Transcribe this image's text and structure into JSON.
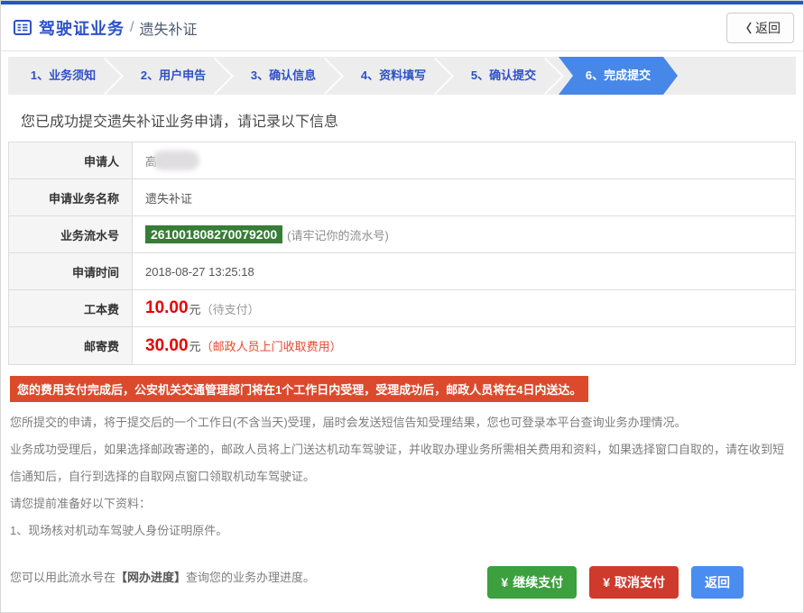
{
  "header": {
    "title": "驾驶证业务",
    "divider": "/",
    "subtitle": "遗失补证",
    "back_button": {
      "chevron": "〈",
      "label": "返回"
    }
  },
  "steps": [
    {
      "label": "1、业务须知",
      "active": false
    },
    {
      "label": "2、用户申告",
      "active": false
    },
    {
      "label": "3、确认信息",
      "active": false
    },
    {
      "label": "4、资料填写",
      "active": false
    },
    {
      "label": "5、确认提交",
      "active": false
    },
    {
      "label": "6、完成提交",
      "active": true
    }
  ],
  "main": {
    "success_message": "您已成功提交遗失补证业务申请，请记录以下信息",
    "table": {
      "rows": [
        {
          "label": "申请人",
          "value": "高"
        },
        {
          "label": "申请业务名称",
          "value": "遗失补证"
        },
        {
          "label": "业务流水号",
          "serial": "261001808270079200",
          "note": "(请牢记你的流水号)"
        },
        {
          "label": "申请时间",
          "value": "2018-08-27 13:25:18"
        },
        {
          "label": "工本费",
          "amount": "10.00",
          "unit": "元",
          "note": "（待支付）"
        },
        {
          "label": "邮寄费",
          "amount": "30.00",
          "unit": "元",
          "note": "（邮政人员上门收取费用）"
        }
      ]
    },
    "alert_banner": "您的费用支付完成后，公安机关交通管理部门将在1个工作日内受理，受理成功后，邮政人员将在4日内送达。",
    "paragraphs": [
      "您所提交的申请，将于提交后的一个工作日(不含当天)受理，届时会发送短信告知受理结果，您也可登录本平台查询业务办理情况。",
      "业务成功受理后，如果选择邮政寄递的，邮政人员将上门送达机动车驾驶证，并收取办理业务所需相关费用和资料，如果选择窗口自取的，请在收到短信通知后，自行到选择的自取网点窗口领取机动车驾驶证。",
      "请您提前准备好以下资料：",
      "1、现场核对机动车驾驶人身份证明原件。"
    ],
    "progress_note": {
      "prefix": "您可以用此流水号在",
      "link": "【网办进度】",
      "suffix": "查询您的业务办理进度。"
    }
  },
  "footer": {
    "buttons": [
      {
        "currency": "¥",
        "label": "继续支付"
      },
      {
        "currency": "¥",
        "label": "取消支付"
      },
      {
        "label": "返回"
      }
    ]
  },
  "colors": {
    "top_bar": "#2257c4",
    "accent_blue": "#2d51c8",
    "step_active": "#4687e8",
    "serial_badge": "#377d37",
    "alert_banner": "#dc4a2e",
    "fee_red": "#e60000",
    "button_green": "#3ba03d",
    "button_red": "#ce3b2d",
    "button_blue": "#4a8cf0"
  }
}
